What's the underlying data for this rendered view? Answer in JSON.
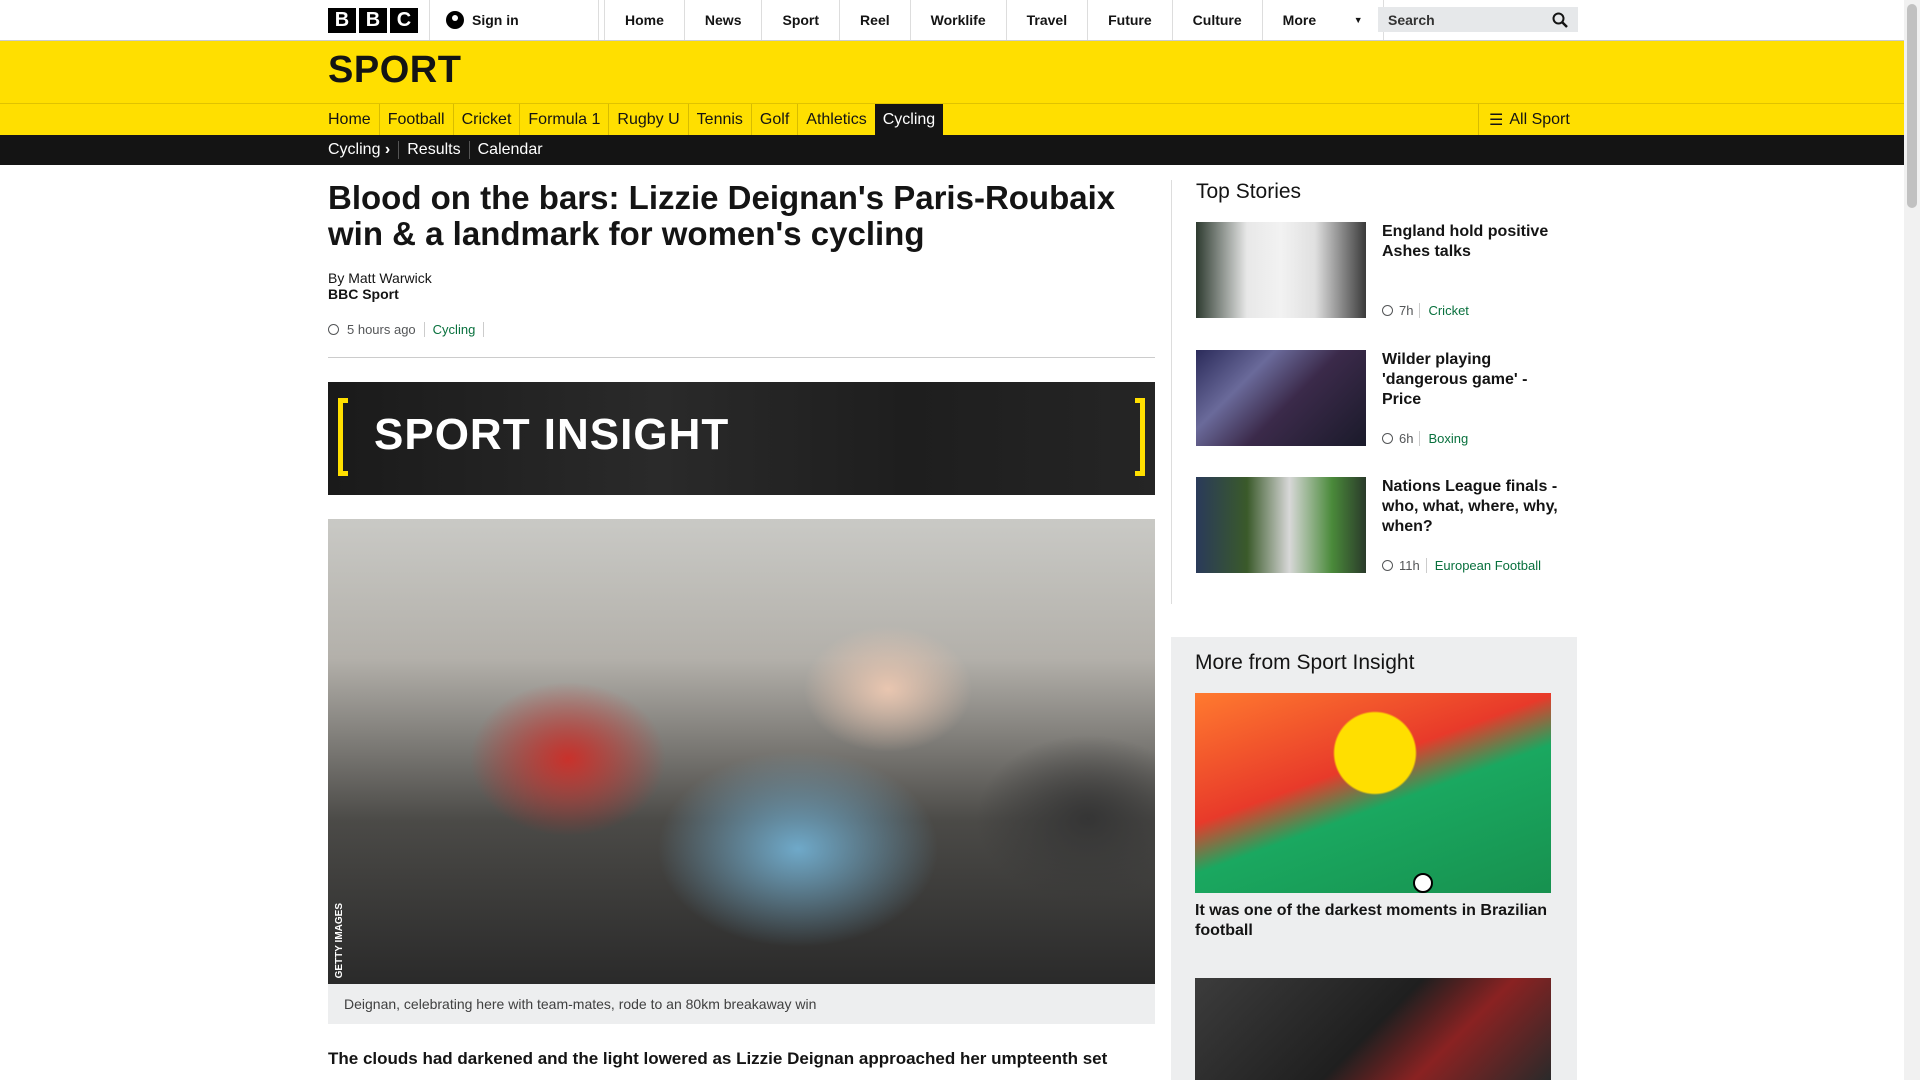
{
  "header": {
    "logo_letters": [
      "B",
      "B",
      "C"
    ],
    "signin_label": "Sign in",
    "nav": [
      "Home",
      "News",
      "Sport",
      "Reel",
      "Worklife",
      "Travel",
      "Future",
      "Culture"
    ],
    "more_label": "More",
    "search_placeholder": "Search"
  },
  "sport_header": {
    "title": "SPORT"
  },
  "sport_nav": {
    "items": [
      "Home",
      "Football",
      "Cricket",
      "Formula 1",
      "Rugby U",
      "Tennis",
      "Golf",
      "Athletics",
      "Cycling"
    ],
    "active": "Cycling",
    "all_sport_label": "All Sport"
  },
  "sub_nav": {
    "items": [
      "Cycling",
      "Results",
      "Calendar"
    ]
  },
  "article": {
    "headline": "Blood on the bars: Lizzie Deignan's Paris-Roubaix win & a landmark for women's cycling",
    "byline": "By Matt Warwick",
    "source": "BBC Sport",
    "time": "5 hours ago",
    "tag": "Cycling",
    "banner_text": "SPORT INSIGHT",
    "photo_credit": "GETTY IMAGES",
    "caption": "Deignan, celebrating here with team-mates, rode to an 80km breakaway win",
    "lead": "The clouds had darkened and the light lowered as Lizzie Deignan approached her umpteenth set"
  },
  "top_stories": {
    "heading": "Top Stories",
    "items": [
      {
        "title": "England hold positive Ashes talks",
        "time": "7h",
        "tag": "Cricket"
      },
      {
        "title": "Wilder playing 'dangerous game' - Price",
        "time": "6h",
        "tag": "Boxing"
      },
      {
        "title": "Nations League finals - who, what, where, why, when?",
        "time": "11h",
        "tag": "European Football"
      }
    ]
  },
  "more_from": {
    "heading": "More from Sport Insight",
    "feature_title": "It was one of the darkest moments in Brazilian football"
  },
  "colors": {
    "brand_yellow": "#ffdf00",
    "tag_green": "#08703d",
    "dark": "#141414"
  }
}
